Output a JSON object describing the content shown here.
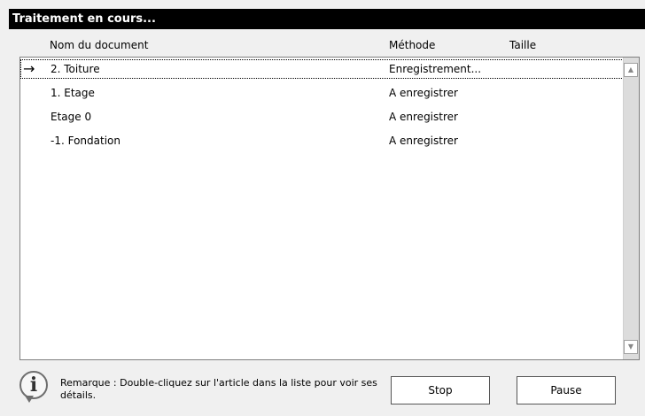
{
  "window": {
    "title": "Traitement en cours..."
  },
  "columns": {
    "name": "Nom du document",
    "method": "Méthode",
    "size": "Taille"
  },
  "documents": [
    {
      "name": "2. Toiture",
      "method": "Enregistrement...",
      "size": "",
      "current": true
    },
    {
      "name": "1. Etage",
      "method": "A enregistrer",
      "size": ""
    },
    {
      "name": "Etage 0",
      "method": "A enregistrer",
      "size": ""
    },
    {
      "name": "-1. Fondation",
      "method": "A enregistrer",
      "size": ""
    }
  ],
  "icons": {
    "current_row": "right-arrow-icon",
    "info": "info-icon",
    "scroll_up": "scroll-up-arrow-icon",
    "scroll_down": "scroll-down-arrow-icon"
  },
  "remark": "Remarque : Double-cliquez sur l'article dans la liste pour voir ses détails.",
  "buttons": {
    "stop": "Stop",
    "pause": "Pause"
  }
}
